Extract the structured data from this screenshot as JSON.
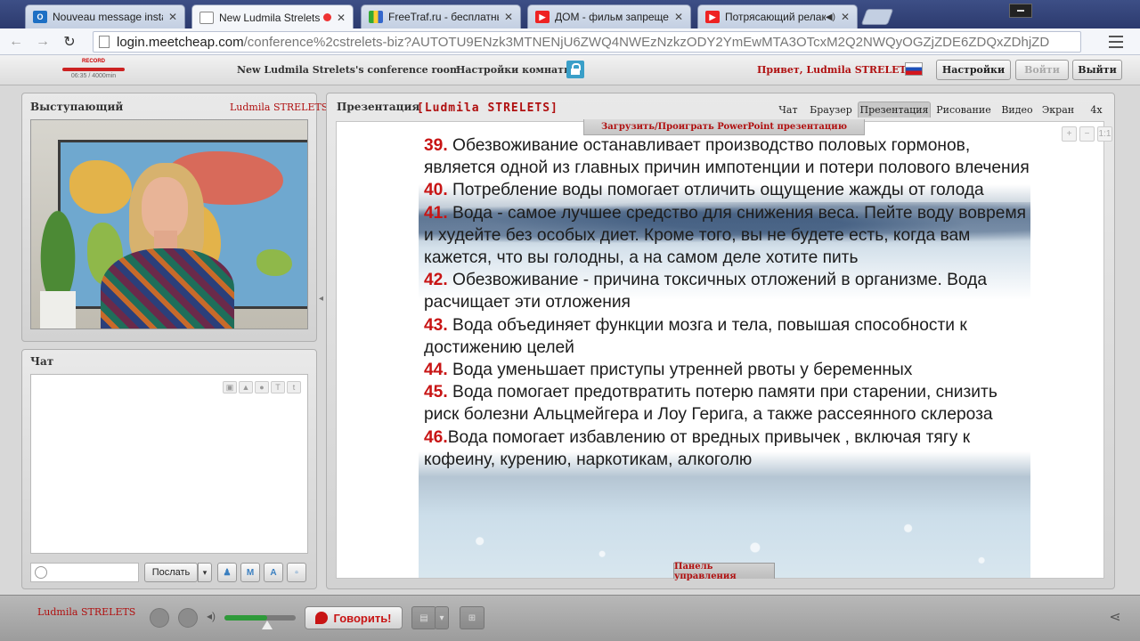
{
  "browser": {
    "tabs": [
      {
        "label": "Nouveau message instan",
        "icon": "outlook-icon",
        "close": "✕"
      },
      {
        "label": "New Ludmila Strelets s",
        "icon": "page-icon",
        "close": "✕",
        "active": true
      },
      {
        "label": "FreeTraf.ru - бесплатный",
        "icon": "chart-icon",
        "close": "✕"
      },
      {
        "label": "ДОМ - фильм запрещен",
        "icon": "youtube-icon",
        "close": "✕"
      },
      {
        "label": "Потрясающий релакс",
        "icon": "youtube-icon",
        "close": "✕"
      }
    ],
    "url_host": "login.meetcheap.com",
    "url_path": "/conference%2cstrelets-biz?AUTOTU9ENzk3MTNENjU6ZWQ4NWEzNzkzODY2YmEwMTA3OTcxM2Q2NWQyOGZjZDE6ZDQxZDhjZD"
  },
  "header": {
    "record_label": "RECORD",
    "record_time": "06:35 / 4000min",
    "room_title": "New Ludmila Strelets's conference room",
    "room_settings": "Настройки комнаты",
    "greeting": "Привет, Ludmila STRELETS",
    "settings_btn": "Настройки",
    "login_btn": "Войти",
    "logout_btn": "Выйти"
  },
  "speaker_panel": {
    "title": "Выступающий",
    "name": "Ludmila STRELETS"
  },
  "chat_panel": {
    "title": "Чат",
    "send_label": "Послать"
  },
  "presentation": {
    "title": "Презентация",
    "presenter": "[Ludmila STRELETS]",
    "tabs": [
      "Чат",
      "Браузер",
      "Презентация",
      "Рисование",
      "Видео",
      "Экран",
      "4x"
    ],
    "active_tab": "Презентация",
    "upload_label": "Загрузить/Проиграть PowerPoint презентацию",
    "control_panel_label": "Панель управления",
    "zoom_ratio": "1:1",
    "items": [
      {
        "num": "39.",
        "text": " Обезвоживание останавливает производство половых гормонов, является одной из главных причин импотенции и потери полового влечения"
      },
      {
        "num": "40.",
        "text": " Потребление воды помогает отличить ощущение жажды от голода"
      },
      {
        "num": "41.",
        "text": " Вода - самое лучшее средство для снижения веса. Пейте воду вовремя и худейте без особых диет. Кроме того, вы не будете есть, когда вам кажется, что вы голодны, а на самом деле хотите пить"
      },
      {
        "num": "42.",
        "text": " Обезвоживание - причина токсичных отложений в организме. Вода расчищает эти отложения"
      },
      {
        "num": "43.",
        "text": " Вода объединяет функции мозга и тела, повышая способности к достижению целей"
      },
      {
        "num": "44.",
        "text": " Вода уменьшает приступы утренней рвоты у беременных"
      },
      {
        "num": "45.",
        "text": " Вода помогает предотвратить потерю памяти при старении, снизить риск болезни Альцмейгера и Лоу Герига, а также рассеянного склероза"
      },
      {
        "num": "46.",
        "text": "Вода помогает избавлению от вредных привычек , включая тягу к кофеину, курению, наркотикам, алкоголю"
      }
    ]
  },
  "bottom_bar": {
    "user_name": "Ludmila STRELETS",
    "speak_label": "Говорить!",
    "volume_level": 0.6
  }
}
